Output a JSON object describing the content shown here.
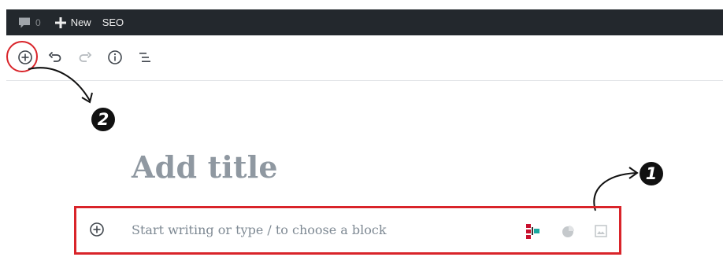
{
  "admin_bar": {
    "comments": {
      "icon": "comment-icon",
      "count": "0"
    },
    "new": {
      "icon": "plus-icon",
      "label": "New"
    },
    "seo": {
      "label": "SEO"
    }
  },
  "toolbar": {
    "buttons": [
      {
        "name": "block-inserter",
        "icon": "plus-circle-icon"
      },
      {
        "name": "undo",
        "icon": "undo-icon"
      },
      {
        "name": "redo",
        "icon": "redo-icon",
        "disabled": true
      },
      {
        "name": "content-structure",
        "icon": "info-icon"
      },
      {
        "name": "block-navigation",
        "icon": "list-icon"
      }
    ]
  },
  "annotations": [
    {
      "label": "2",
      "color": "#111111"
    },
    {
      "label": "1",
      "color": "#111111"
    }
  ],
  "editor": {
    "title_placeholder": "Add title",
    "block_placeholder": "Start writing or type / to choose a block",
    "block_icons": [
      "plus-circle-icon",
      "tabular-block-icon",
      "pie-chart-icon",
      "image-icon"
    ]
  },
  "colors": {
    "admin_bar_bg": "#23282d",
    "annotation_red": "#d9242a",
    "placeholder_gray": "#8f98a1"
  }
}
